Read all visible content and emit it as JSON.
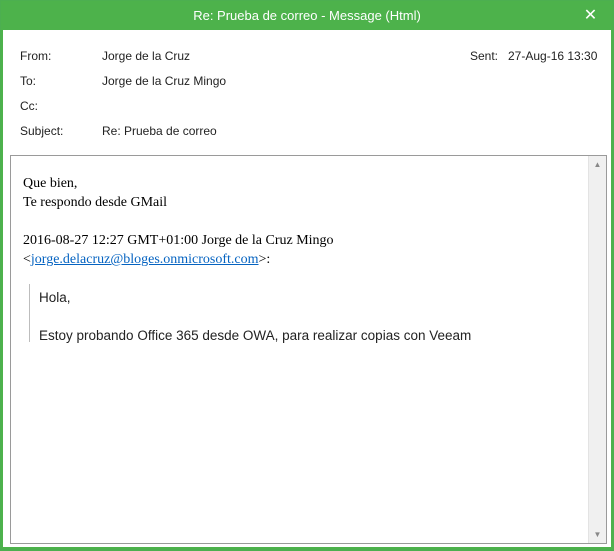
{
  "window": {
    "title": "Re: Prueba de correo - Message (Html)",
    "close_glyph": "✕"
  },
  "header": {
    "from_label": "From:",
    "from_value": "Jorge de la Cruz",
    "sent_label": "Sent:",
    "sent_value": "27-Aug-16 13:30",
    "to_label": "To:",
    "to_value": "Jorge de la Cruz Mingo",
    "cc_label": "Cc:",
    "cc_value": "",
    "subject_label": "Subject:",
    "subject_value": "Re: Prueba de correo"
  },
  "body": {
    "line1": "Que bien,",
    "line2": "Te respondo desde GMail",
    "quote_intro": "2016-08-27 12:27 GMT+01:00 Jorge de la Cruz Mingo",
    "email_open": "<",
    "email_link": "jorge.delacruz@bloges.onmicrosoft.com",
    "email_close": ">:",
    "quoted_greeting": "Hola,",
    "quoted_text": "Estoy probando Office 365 desde OWA, para realizar copias con Veeam"
  },
  "scrollbar": {
    "up_glyph": "▲",
    "down_glyph": "▼"
  },
  "colors": {
    "titlebar": "#4db24b",
    "link": "#0563c1"
  }
}
